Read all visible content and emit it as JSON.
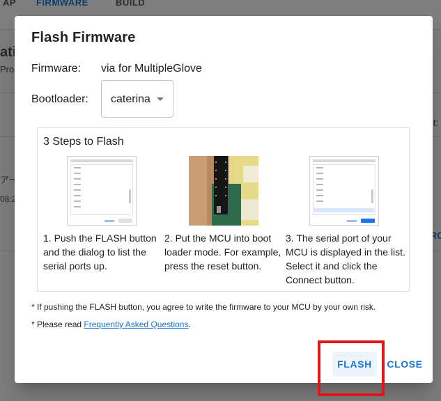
{
  "background": {
    "tabs": [
      {
        "label": "AP",
        "active": false
      },
      {
        "label": "FIRMWARE",
        "active": true
      },
      {
        "label": "BUILD",
        "active": false
      }
    ],
    "fragments": [
      "ati",
      "Pro",
      "nt:",
      "アー",
      "08:2",
      "RC"
    ]
  },
  "dialog": {
    "title": "Flash Firmware",
    "firmware_label": "Firmware:",
    "firmware_value": "via for MultipleGlove",
    "bootloader_label": "Bootloader:",
    "bootloader_value": "caterina",
    "steps_title": "3 Steps to Flash",
    "steps": [
      {
        "text": "1. Push the FLASH button and the dialog to list the serial ports up.",
        "image": "port-list-screenshot"
      },
      {
        "text": "2. Put the MCU into boot loader mode. For example, press the reset button.",
        "image": "mcu-photo"
      },
      {
        "text": "3. The serial port of your MCU is displayed in the list. Select it and click the Connect button.",
        "image": "port-selected-screenshot"
      }
    ],
    "note1": "* If pushing the FLASH button, you agree to write the firmware to your MCU by your own risk.",
    "note2_prefix": "* Please read ",
    "note2_link": "Frequently Asked Questions",
    "note2_suffix": ".",
    "flash_button": "FLASH",
    "close_button": "CLOSE"
  },
  "colors": {
    "accent": "#1976d2",
    "highlight": "#e0161b"
  }
}
